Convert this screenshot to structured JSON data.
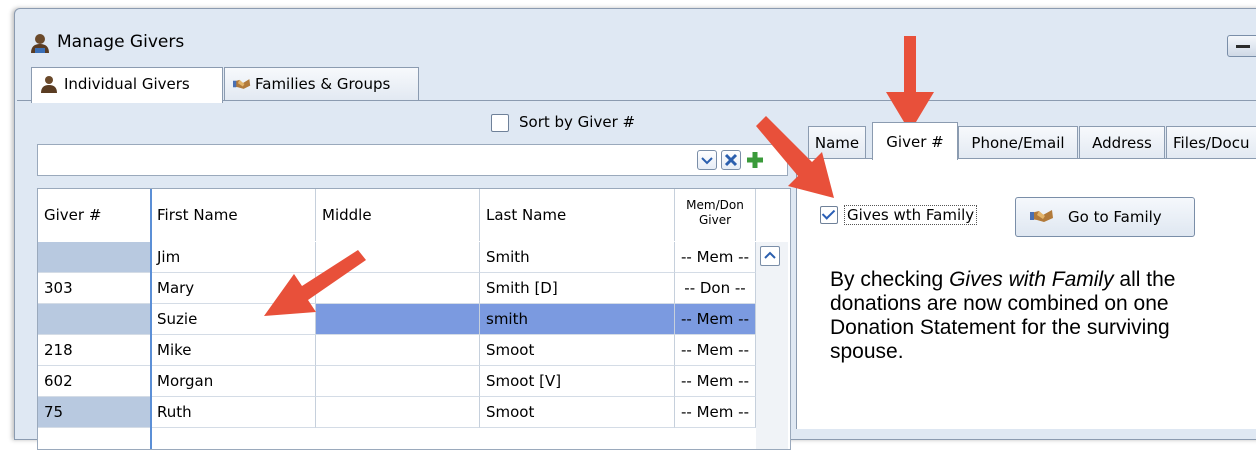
{
  "window": {
    "title": "Manage Givers"
  },
  "tabs": [
    {
      "label": "Individual Givers",
      "active": true
    },
    {
      "label": "Families & Groups",
      "active": false
    }
  ],
  "sort": {
    "label": "Sort by Giver #",
    "checked": false
  },
  "search": {
    "value": ""
  },
  "grid": {
    "columns": [
      "Giver #",
      "First Name",
      "Middle",
      "Last Name",
      "Mem/Don Giver"
    ],
    "mem_don_header": [
      "Mem/Don",
      "Giver"
    ],
    "rows": [
      {
        "giver": "",
        "first": "Jim",
        "middle": "",
        "last": "Smith",
        "type": "-- Mem --"
      },
      {
        "giver": "303",
        "first": "Mary",
        "middle": "",
        "last": "Smith [D]",
        "type": "-- Don --"
      },
      {
        "giver": "",
        "first": "Suzie",
        "middle": "",
        "last": "smith",
        "type": "-- Mem --",
        "selected": true
      },
      {
        "giver": "218",
        "first": "Mike",
        "middle": "",
        "last": "Smoot",
        "type": "-- Mem --"
      },
      {
        "giver": "602",
        "first": "Morgan",
        "middle": "",
        "last": "Smoot [V]",
        "type": "-- Mem --"
      },
      {
        "giver": "75",
        "first": "Ruth",
        "middle": "",
        "last": "Smoot",
        "type": "-- Mem --"
      }
    ]
  },
  "detail_tabs": [
    {
      "label": "Name"
    },
    {
      "label": "Giver #",
      "active": true
    },
    {
      "label": "Phone/Email"
    },
    {
      "label": "Address"
    },
    {
      "label": "Files/Docu"
    }
  ],
  "gives_with_family": {
    "label": "Gives wth Family",
    "checked": true
  },
  "go_to_family": {
    "label": "Go to Family"
  },
  "note": {
    "part1": "By checking ",
    "emph": "Gives with Family",
    "part2": " all the donations are now combined on one Donation Statement for the surviving spouse."
  },
  "colors": {
    "arrow": "#e8503a",
    "selected_row": "#7b9ae0",
    "blank_giver_cell": "#b8c9e0",
    "panel_bg": "#dfe8f3"
  }
}
